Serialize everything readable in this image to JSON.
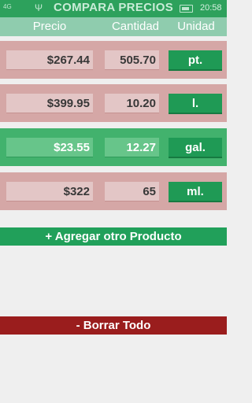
{
  "status_bar": {
    "signal_label": "4G",
    "usb_icon": "usb-icon",
    "battery_icon": "battery-icon",
    "time": "20:58"
  },
  "app": {
    "title": "COMPARA PRECIOS"
  },
  "headers": {
    "precio": "Precio",
    "cantidad": "Cantidad",
    "unidad": "Unidad"
  },
  "products": [
    {
      "precio": "$267.44",
      "cantidad": "505.70",
      "unidad": "pt.",
      "state": "bad"
    },
    {
      "precio": "$399.95",
      "cantidad": "10.20",
      "unidad": "l.",
      "state": "bad"
    },
    {
      "precio": "$23.55",
      "cantidad": "12.27",
      "unidad": "gal.",
      "state": "good"
    },
    {
      "precio": "$322",
      "cantidad": "65",
      "unidad": "ml.",
      "state": "bad"
    }
  ],
  "actions": {
    "add_label": "+ Agregar otro Producto",
    "clear_label": "- Borrar Todo"
  },
  "colors": {
    "brand": "#2da15c",
    "best_row": "#42b26d",
    "worse_row": "#d5a7a6",
    "danger": "#9a1d1d"
  }
}
